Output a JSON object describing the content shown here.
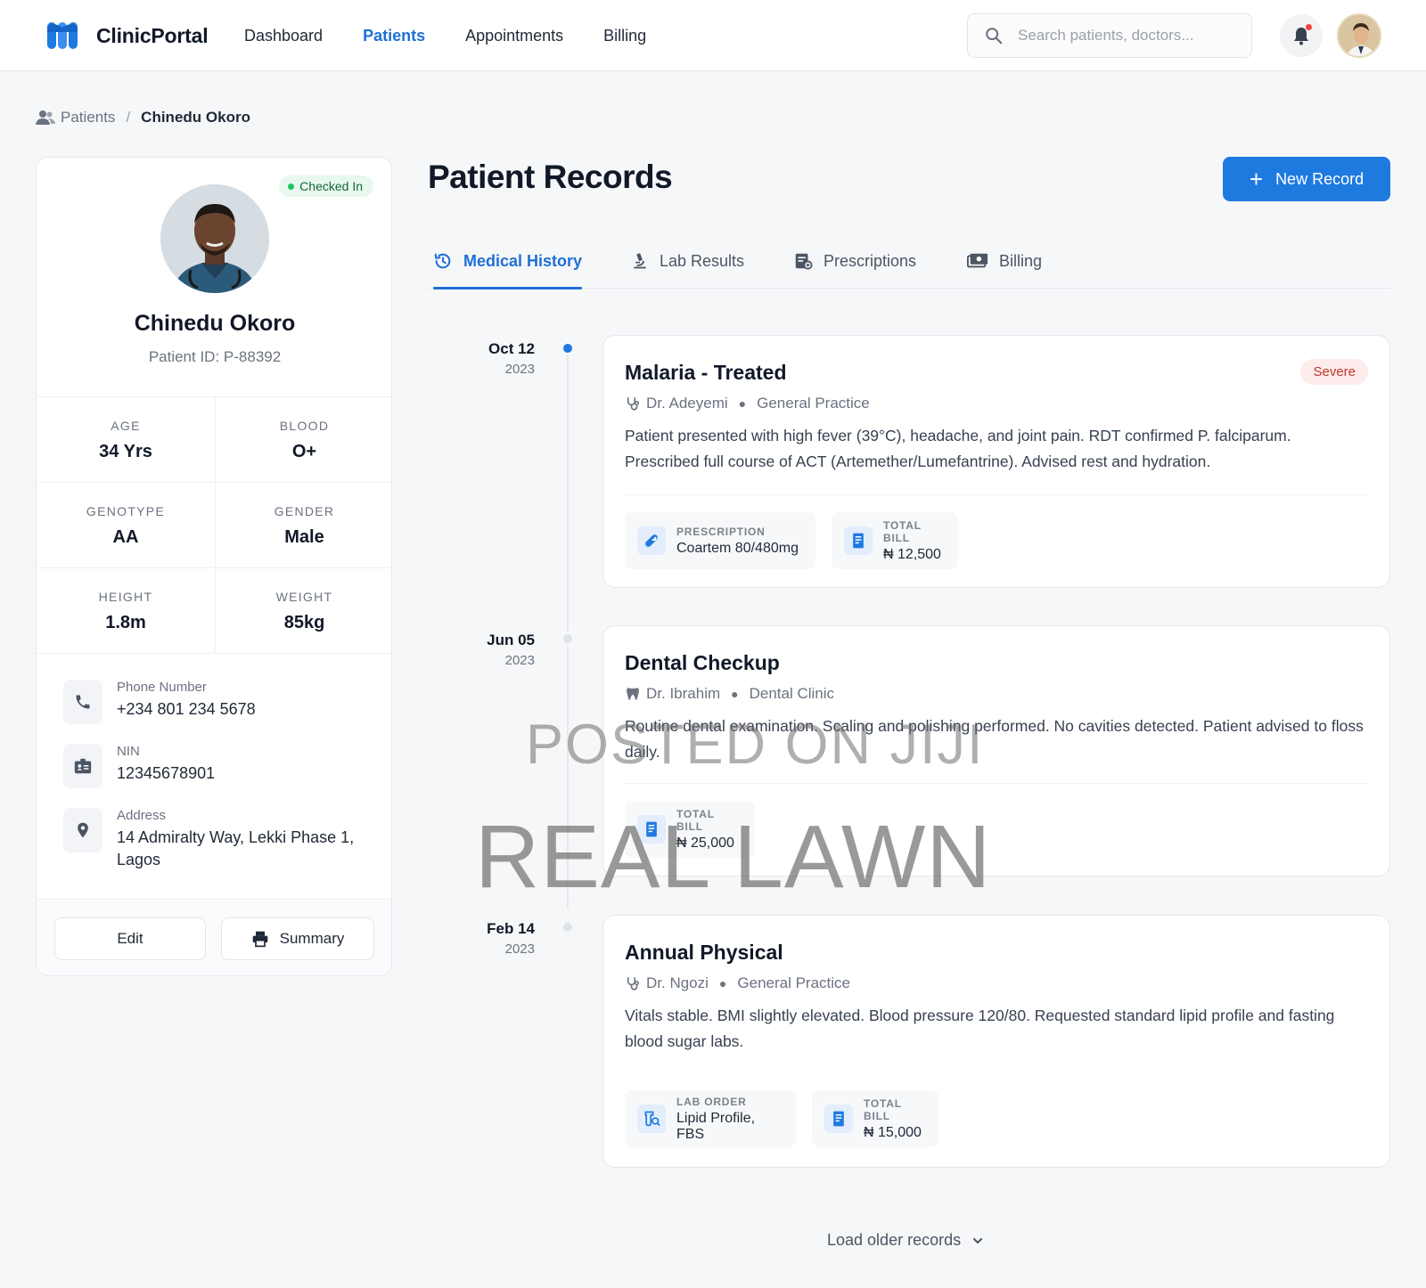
{
  "app": {
    "name": "ClinicPortal",
    "nav": [
      {
        "label": "Dashboard",
        "active": false
      },
      {
        "label": "Patients",
        "active": true
      },
      {
        "label": "Appointments",
        "active": false
      },
      {
        "label": "Billing",
        "active": false
      }
    ],
    "search_placeholder": "Search patients, doctors...",
    "accent_color": "#1f7ae0"
  },
  "breadcrumb": {
    "parent": "Patients",
    "current": "Chinedu Okoro"
  },
  "patient": {
    "status": "Checked In",
    "name": "Chinedu Okoro",
    "id_text": "Patient ID: P-88392",
    "stats": [
      {
        "label": "AGE",
        "value": "34 Yrs"
      },
      {
        "label": "BLOOD",
        "value": "O+"
      },
      {
        "label": "GENOTYPE",
        "value": "AA"
      },
      {
        "label": "GENDER",
        "value": "Male"
      },
      {
        "label": "HEIGHT",
        "value": "1.8m"
      },
      {
        "label": "WEIGHT",
        "value": "85kg"
      }
    ],
    "contact": [
      {
        "label": "Phone Number",
        "value": "+234 801 234 5678",
        "icon": "phone-icon"
      },
      {
        "label": "NIN",
        "value": "12345678901",
        "icon": "id-card-icon"
      },
      {
        "label": "Address",
        "value": "14 Admiralty Way, Lekki Phase 1, Lagos",
        "icon": "location-pin-icon"
      }
    ],
    "edit_label": "Edit",
    "summary_label": "Summary"
  },
  "main": {
    "title": "Patient Records",
    "new_record_label": "New Record",
    "tabs": [
      {
        "label": "Medical History",
        "active": true
      },
      {
        "label": "Lab Results",
        "active": false
      },
      {
        "label": "Prescriptions",
        "active": false
      },
      {
        "label": "Billing",
        "active": false
      }
    ]
  },
  "records": [
    {
      "date": "Oct 12",
      "year": "2023",
      "active": true,
      "title": "Malaria - Treated",
      "severity": "Severe",
      "doctor": "Dr. Adeyemi",
      "department": "General Practice",
      "description": "Patient presented with high fever (39°C), headache, and joint pain. RDT confirmed P. falciparum. Prescribed full course of ACT (Artemether/Lumefantrine). Advised rest and hydration.",
      "chips": [
        {
          "label": "PRESCRIPTION",
          "value": "Coartem 80/480mg",
          "icon": "pill-icon"
        },
        {
          "label": "TOTAL BILL",
          "value": "₦ 12,500",
          "icon": "receipt-icon"
        }
      ]
    },
    {
      "date": "Jun 05",
      "year": "2023",
      "active": false,
      "title": "Dental Checkup",
      "doctor": "Dr. Ibrahim",
      "department": "Dental Clinic",
      "description": "Routine dental examination. Scaling and polishing performed. No cavities detected. Patient advised to floss daily.",
      "chips": [
        {
          "label": "TOTAL BILL",
          "value": "₦ 25,000",
          "icon": "receipt-icon"
        }
      ]
    },
    {
      "date": "Feb 14",
      "year": "2023",
      "active": false,
      "title": "Annual Physical",
      "doctor": "Dr. Ngozi",
      "department": "General Practice",
      "description": "Vitals stable. BMI slightly elevated. Blood pressure 120/80. Requested standard lipid profile and fasting blood sugar labs.",
      "chips": [
        {
          "label": "LAB ORDER",
          "value": "Lipid Profile, FBS",
          "icon": "lab-order-icon"
        },
        {
          "label": "TOTAL BILL",
          "value": "₦ 15,000",
          "icon": "receipt-icon"
        }
      ]
    }
  ],
  "load_more_label": "Load older records",
  "watermark": {
    "line1": "POSTED ON JIJI",
    "line2": "REAL LAWN"
  }
}
